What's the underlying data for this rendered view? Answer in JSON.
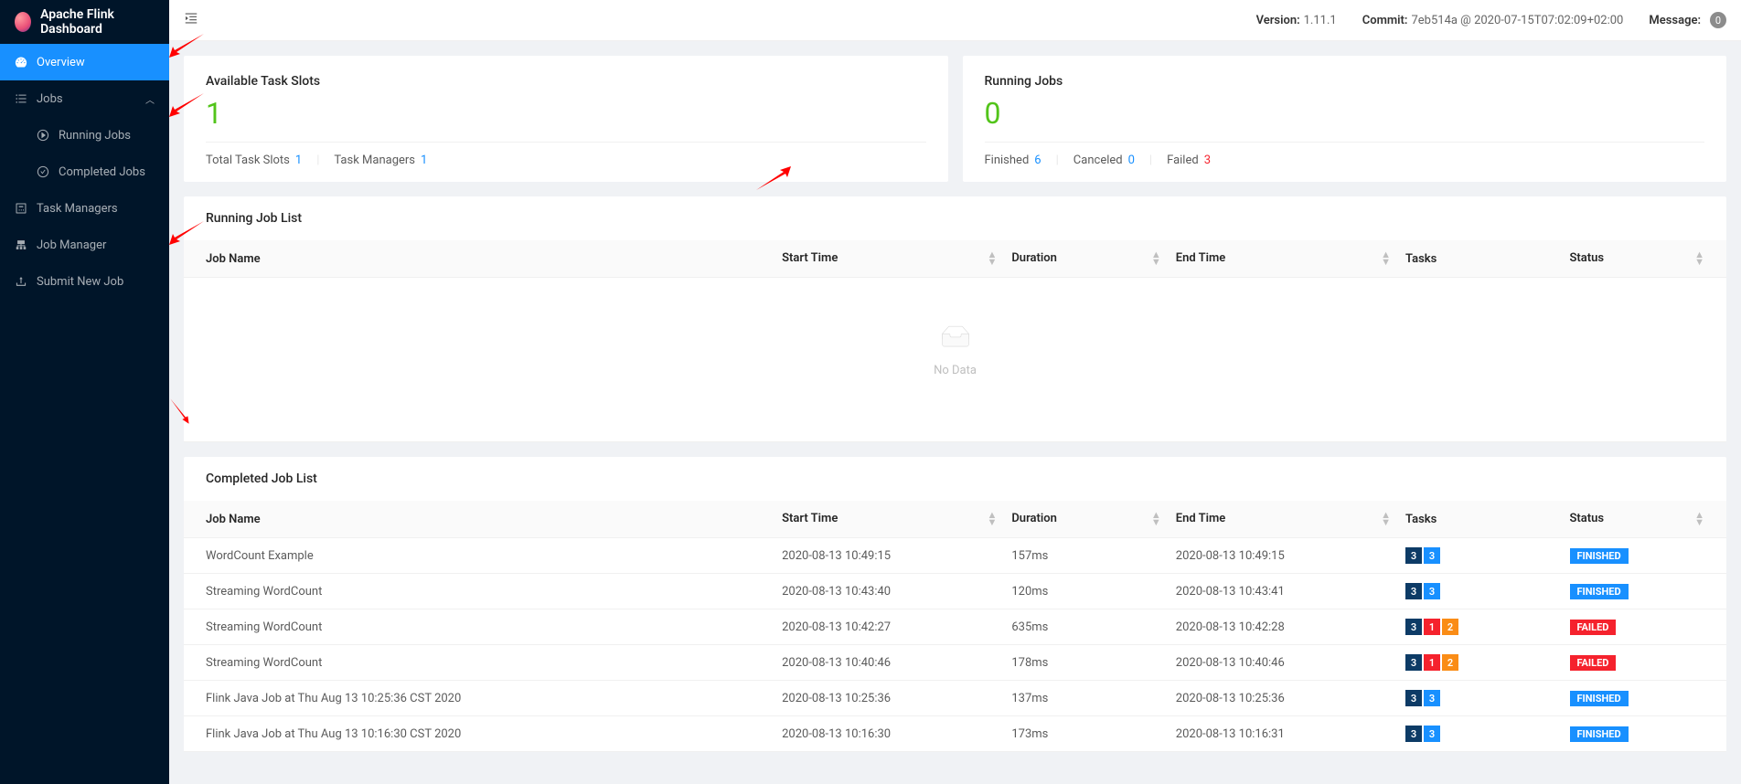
{
  "app_title": "Apache Flink Dashboard",
  "sidebar": {
    "items": [
      {
        "icon": "dashboard",
        "label": "Overview",
        "active": true
      },
      {
        "icon": "bars",
        "label": "Jobs",
        "expandable": true,
        "expanded": true
      },
      {
        "icon": "play-circle",
        "label": "Running Jobs",
        "sub": true
      },
      {
        "icon": "check-circle",
        "label": "Completed Jobs",
        "sub": true
      },
      {
        "icon": "server",
        "label": "Task Managers"
      },
      {
        "icon": "cluster",
        "label": "Job Manager"
      },
      {
        "icon": "upload",
        "label": "Submit New Job"
      }
    ]
  },
  "topbar": {
    "version_label": "Version:",
    "version_value": "1.11.1",
    "commit_label": "Commit:",
    "commit_value": "7eb514a @ 2020-07-15T07:02:09+02:00",
    "message_label": "Message:",
    "message_count": "0"
  },
  "stats": {
    "slots": {
      "title": "Available Task Slots",
      "value": "1",
      "total_label": "Total Task Slots",
      "total_value": "1",
      "managers_label": "Task Managers",
      "managers_value": "1"
    },
    "running": {
      "title": "Running Jobs",
      "value": "0",
      "finished_label": "Finished",
      "finished_value": "6",
      "canceled_label": "Canceled",
      "canceled_value": "0",
      "failed_label": "Failed",
      "failed_value": "3"
    }
  },
  "running_section": {
    "title": "Running Job List",
    "empty_text": "No Data"
  },
  "completed_section": {
    "title": "Completed Job List"
  },
  "columns": {
    "job_name": "Job Name",
    "start_time": "Start Time",
    "duration": "Duration",
    "end_time": "End Time",
    "tasks": "Tasks",
    "status": "Status"
  },
  "completed_jobs": [
    {
      "name": "WordCount Example",
      "start": "2020-08-13 10:49:15",
      "duration": "157ms",
      "end": "2020-08-13 10:49:15",
      "tasks": [
        {
          "c": "navy",
          "v": "3"
        },
        {
          "c": "blue",
          "v": "3"
        }
      ],
      "status": "FINISHED"
    },
    {
      "name": "Streaming WordCount",
      "start": "2020-08-13 10:43:40",
      "duration": "120ms",
      "end": "2020-08-13 10:43:41",
      "tasks": [
        {
          "c": "navy",
          "v": "3"
        },
        {
          "c": "blue",
          "v": "3"
        }
      ],
      "status": "FINISHED"
    },
    {
      "name": "Streaming WordCount",
      "start": "2020-08-13 10:42:27",
      "duration": "635ms",
      "end": "2020-08-13 10:42:28",
      "tasks": [
        {
          "c": "navy",
          "v": "3"
        },
        {
          "c": "red",
          "v": "1"
        },
        {
          "c": "orange",
          "v": "2"
        }
      ],
      "status": "FAILED"
    },
    {
      "name": "Streaming WordCount",
      "start": "2020-08-13 10:40:46",
      "duration": "178ms",
      "end": "2020-08-13 10:40:46",
      "tasks": [
        {
          "c": "navy",
          "v": "3"
        },
        {
          "c": "red",
          "v": "1"
        },
        {
          "c": "orange",
          "v": "2"
        }
      ],
      "status": "FAILED"
    },
    {
      "name": "Flink Java Job at Thu Aug 13 10:25:36 CST 2020",
      "start": "2020-08-13 10:25:36",
      "duration": "137ms",
      "end": "2020-08-13 10:25:36",
      "tasks": [
        {
          "c": "navy",
          "v": "3"
        },
        {
          "c": "blue",
          "v": "3"
        }
      ],
      "status": "FINISHED"
    },
    {
      "name": "Flink Java Job at Thu Aug 13 10:16:30 CST 2020",
      "start": "2020-08-13 10:16:30",
      "duration": "173ms",
      "end": "2020-08-13 10:16:31",
      "tasks": [
        {
          "c": "navy",
          "v": "3"
        },
        {
          "c": "blue",
          "v": "3"
        }
      ],
      "status": "FINISHED"
    }
  ]
}
